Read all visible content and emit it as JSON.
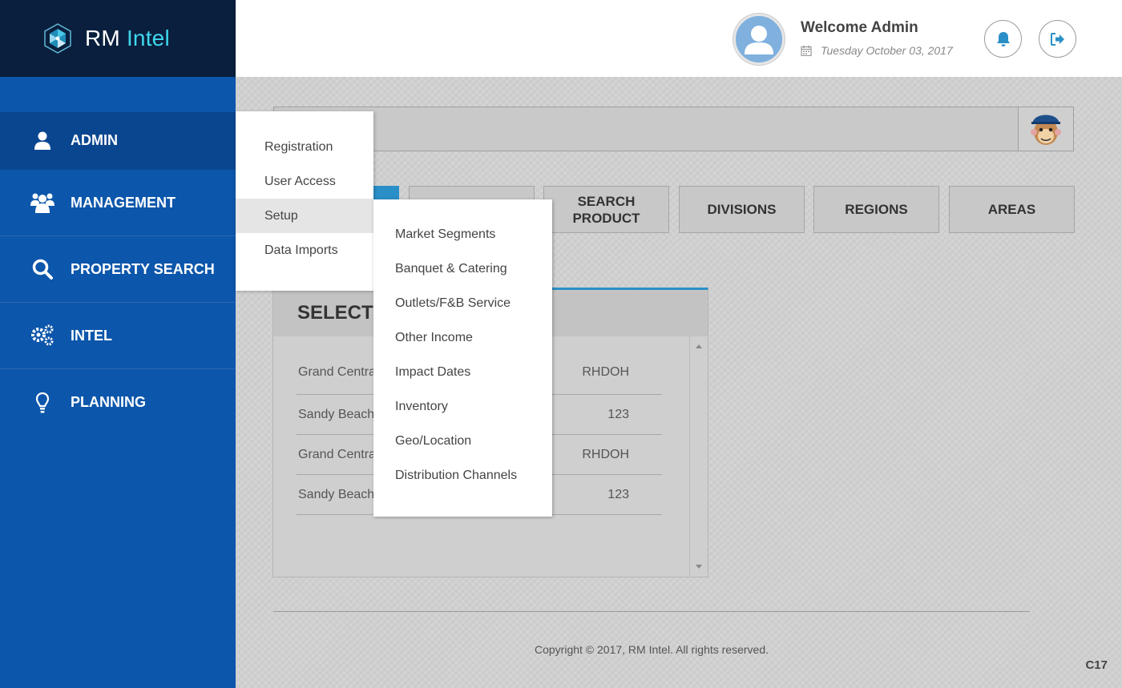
{
  "brand": {
    "name_part1": "RM",
    "name_part2": "Intel"
  },
  "sidebar": {
    "items": [
      {
        "label": "ADMIN",
        "icon": "user-icon"
      },
      {
        "label": "MANAGEMENT",
        "icon": "users-icon"
      },
      {
        "label": "PROPERTY SEARCH",
        "icon": "search-icon"
      },
      {
        "label": "INTEL",
        "icon": "gears-icon"
      },
      {
        "label": "PLANNING",
        "icon": "lightbulb-icon"
      }
    ]
  },
  "header": {
    "welcome": "Welcome Admin",
    "date": "Tuesday October 03, 2017"
  },
  "tabs": [
    {
      "label": ""
    },
    {
      "label": ""
    },
    {
      "label": "SEARCH PRODUCT"
    },
    {
      "label": "DIVISIONS"
    },
    {
      "label": "REGIONS"
    },
    {
      "label": "AREAS"
    }
  ],
  "panel": {
    "title": "SELECT",
    "rows": [
      {
        "name": "Grand Centra",
        "code": "RHDOH"
      },
      {
        "name": "Sandy Beach",
        "code": "123"
      },
      {
        "name": "Grand Centra",
        "code": "RHDOH"
      },
      {
        "name": "Sandy Beach",
        "code": "123"
      }
    ]
  },
  "admin_menu": {
    "items": [
      "Registration",
      "User Access",
      "Setup",
      "Data Imports"
    ]
  },
  "setup_menu": {
    "items": [
      "Market Segments",
      "Banquet & Catering",
      "Outlets/F&B Service",
      "Other Income",
      "Impact Dates",
      "Inventory",
      "Geo/Location",
      "Distribution Channels"
    ]
  },
  "footer": {
    "copyright": "Copyright © 2017, RM Intel. All rights reserved.",
    "version": "C17"
  },
  "colors": {
    "sidebar": "#0c56ab",
    "sidebar_active": "#0a4690",
    "logo_bar": "#0a1f3d",
    "accent": "#2a8fc7",
    "logo_accent": "#3fd8ee"
  }
}
